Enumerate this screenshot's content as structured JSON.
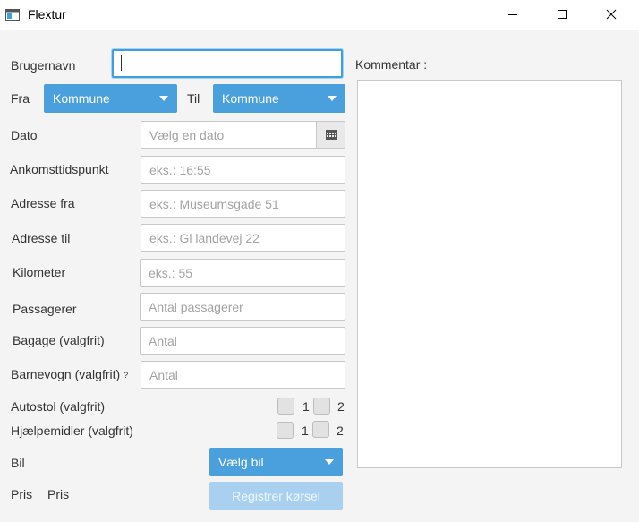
{
  "window": {
    "title": "Flextur",
    "icons": {
      "app": "window-icon",
      "minimize": "minimize-icon",
      "maximize": "maximize-icon",
      "close": "close-icon"
    }
  },
  "form": {
    "username": {
      "label": "Brugernavn",
      "value": "",
      "placeholder": ""
    },
    "from": {
      "label": "Fra",
      "selected": "Kommune"
    },
    "to": {
      "label": "Til",
      "selected": "Kommune"
    },
    "date": {
      "label": "Dato",
      "placeholder": "Vælg en dato"
    },
    "arrival_time": {
      "label": "Ankomsttidspunkt",
      "placeholder": "eks.: 16:55"
    },
    "address_from": {
      "label": "Adresse fra",
      "placeholder": "eks.: Museumsgade 51"
    },
    "address_to": {
      "label": "Adresse til",
      "placeholder": "eks.: Gl landevej 22"
    },
    "kilometer": {
      "label": "Kilometer",
      "placeholder": "eks.: 55"
    },
    "passengers": {
      "label": "Passagerer",
      "placeholder": "Antal passagerer"
    },
    "luggage": {
      "label": "Bagage (valgfrit)",
      "placeholder": "Antal"
    },
    "stroller": {
      "label": "Barnevogn (valgfrit)",
      "hint": "?",
      "placeholder": "Antal"
    },
    "car_seat": {
      "label": "Autostol (valgfrit)",
      "options": [
        "1",
        "2"
      ]
    },
    "aids": {
      "label": "Hjælpemidler (valgfrit)",
      "options": [
        "1",
        "2"
      ]
    },
    "car": {
      "label": "Bil",
      "selected": "Vælg bil"
    },
    "price": {
      "label": "Pris",
      "value": "Pris"
    },
    "register_label": "Registrer kørsel"
  },
  "comment": {
    "label": "Kommentar :"
  },
  "colors": {
    "accent": "#4a9fdd",
    "focus": "#3d9ee0",
    "disabled_button": "#a9d1ef"
  }
}
